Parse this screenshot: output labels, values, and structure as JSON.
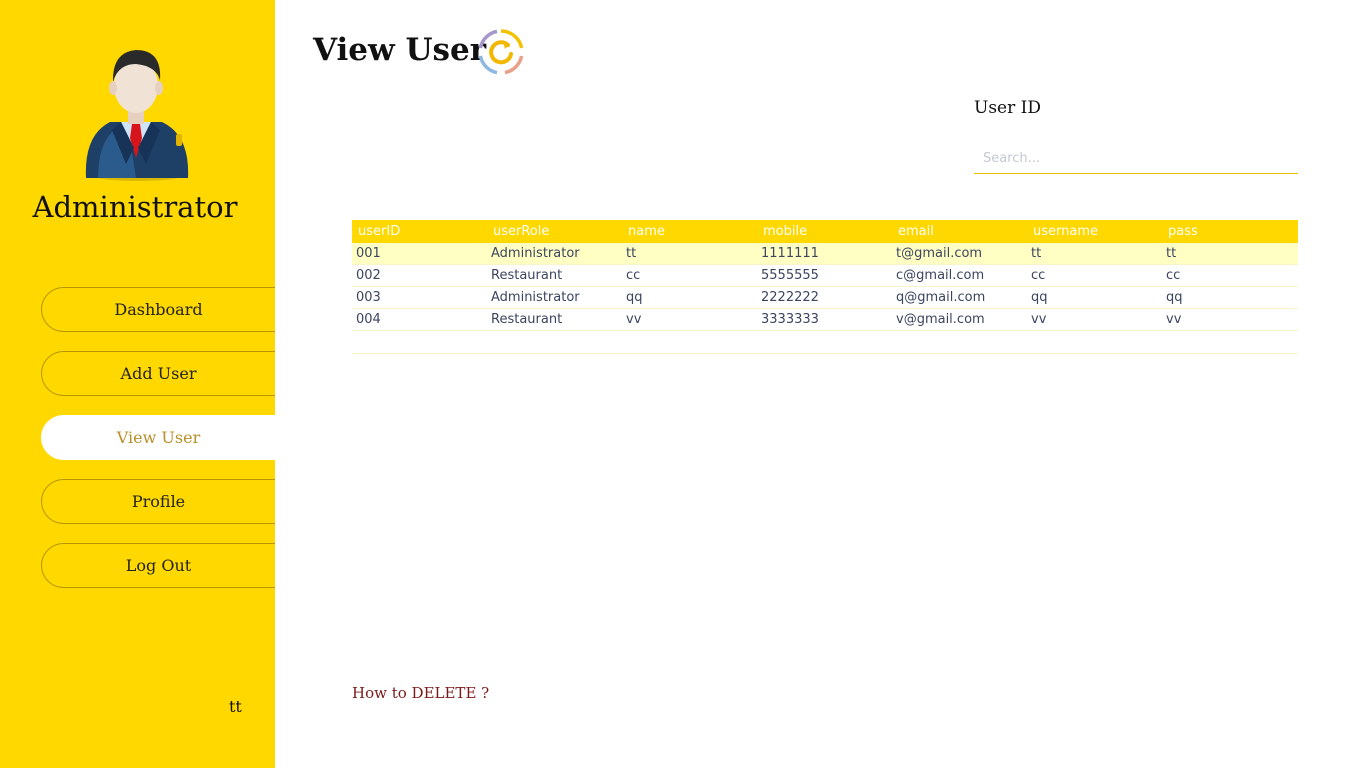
{
  "sidebar": {
    "role_title": "Administrator",
    "nav": [
      {
        "label": "Dashboard",
        "active": false
      },
      {
        "label": "Add User",
        "active": false
      },
      {
        "label": "View User",
        "active": true
      },
      {
        "label": "Profile",
        "active": false
      },
      {
        "label": "Log Out",
        "active": false
      }
    ],
    "user_name": "tt",
    "avatar_icon": "businessman-avatar-icon"
  },
  "header": {
    "title": "View User",
    "refresh_icon": "refresh-icon"
  },
  "search": {
    "label": "User ID",
    "placeholder": "Search..."
  },
  "table": {
    "columns": [
      "userID",
      "userRole",
      "name",
      "mobile",
      "email",
      "username",
      "pass"
    ],
    "rows": [
      [
        "001",
        "Administrator",
        "tt",
        "1111111",
        "t@gmail.com",
        "tt",
        "tt"
      ],
      [
        "002",
        "Restaurant",
        "cc",
        "5555555",
        "c@gmail.com",
        "cc",
        "cc"
      ],
      [
        "003",
        "Administrator",
        "qq",
        "2222222",
        "q@gmail.com",
        "qq",
        "qq"
      ],
      [
        "004",
        "Restaurant",
        "vv",
        "3333333",
        "v@gmail.com",
        "vv",
        "vv"
      ]
    ],
    "selected_row": 0
  },
  "help_link": "How to DELETE ?",
  "colors": {
    "sidebar": "#FFD800",
    "accent_text": "#B8902A",
    "link": "#7a1a1a",
    "selected_row": "#FFFFC4"
  }
}
